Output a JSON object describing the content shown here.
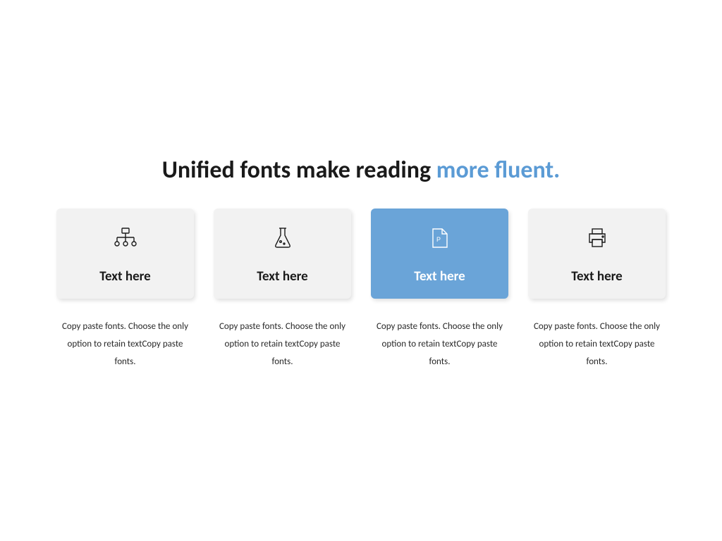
{
  "title": {
    "part1": "Unified fonts make reading ",
    "part2": "more fluent."
  },
  "cards": [
    {
      "label": "Text here",
      "desc": "Copy paste fonts. Choose the only option to retain textCopy paste fonts."
    },
    {
      "label": "Text here",
      "desc": "Copy paste fonts. Choose the only option to retain textCopy paste fonts."
    },
    {
      "label": "Text here",
      "desc": "Copy paste fonts. Choose the only option to retain textCopy paste fonts."
    },
    {
      "label": "Text here",
      "desc": "Copy paste fonts. Choose the only option to retain textCopy paste fonts."
    }
  ]
}
